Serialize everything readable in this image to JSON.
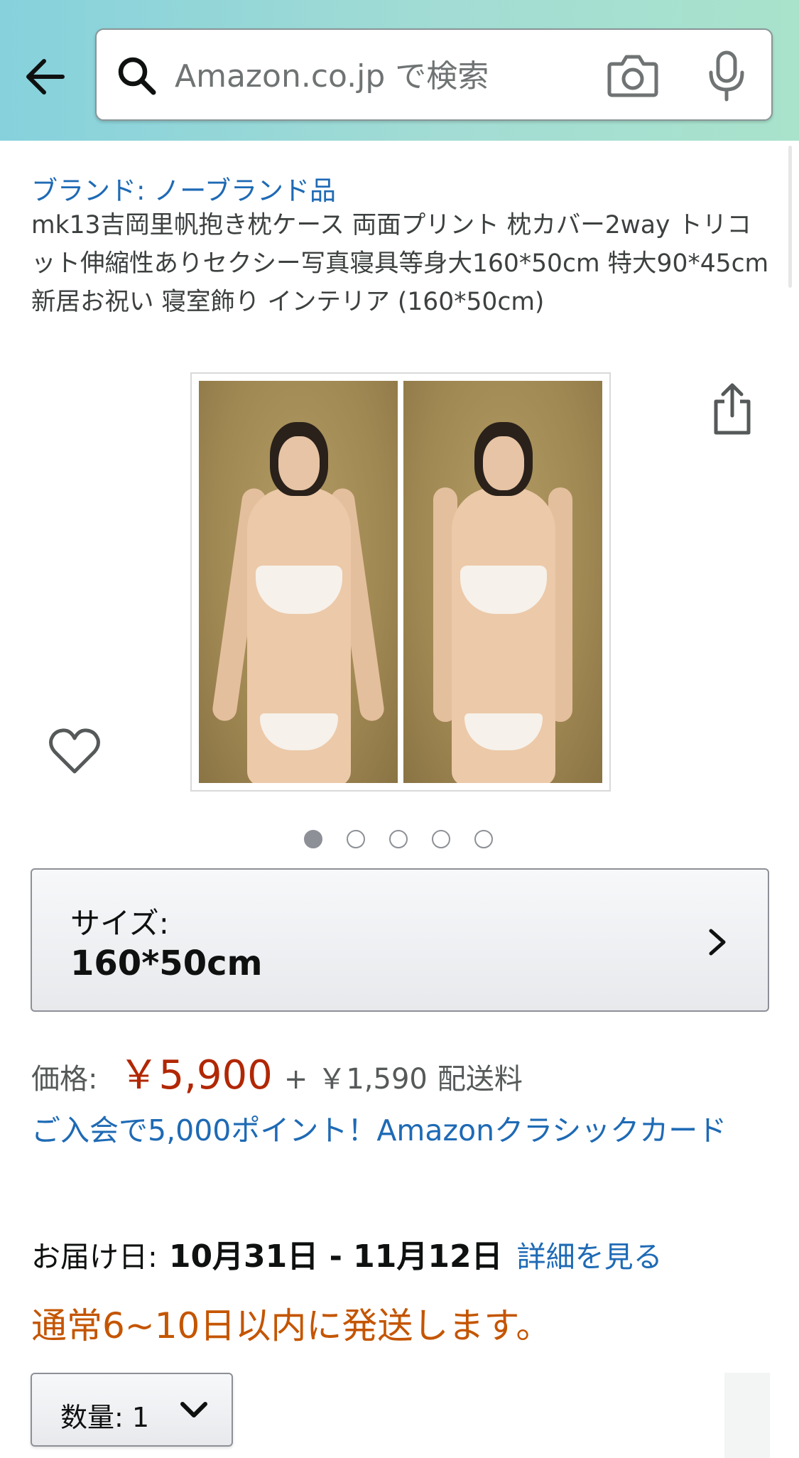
{
  "header": {
    "search_placeholder": "Amazon.co.jp で検索",
    "icons": [
      "back-arrow-icon",
      "search-icon",
      "camera-icon",
      "microphone-icon"
    ]
  },
  "product": {
    "brand": "ブランド: ノーブランド品",
    "title": "mk13吉岡里帆抱き枕ケース 両面プリント 枕カバー2way トリコット伸縮性ありセクシー写真寝具等身大160*50cm 特大90*45cm 新居お祝い 寝室飾り インテリア (160*50cm)",
    "image_count": 5,
    "active_image": 1
  },
  "size_selector": {
    "label": "サイズ:",
    "value": "160*50cm"
  },
  "price": {
    "label": "価格:",
    "value": "￥5,900",
    "plus": "+",
    "shipping_price": "￥1,590",
    "shipping_label": "配送料"
  },
  "promo": {
    "text": "ご入会で5,000ポイント！Amazonクラシックカード"
  },
  "delivery": {
    "label": "お届け日:",
    "dates": "10月31日 - 11月12日",
    "details_link": "詳細を見る",
    "notice": "通常6~10日以内に発送します。"
  },
  "quantity": {
    "label": "数量:",
    "value": "1"
  },
  "colors": {
    "link": "#1e6ab5",
    "price": "#b12704",
    "notice": "#c45500"
  }
}
